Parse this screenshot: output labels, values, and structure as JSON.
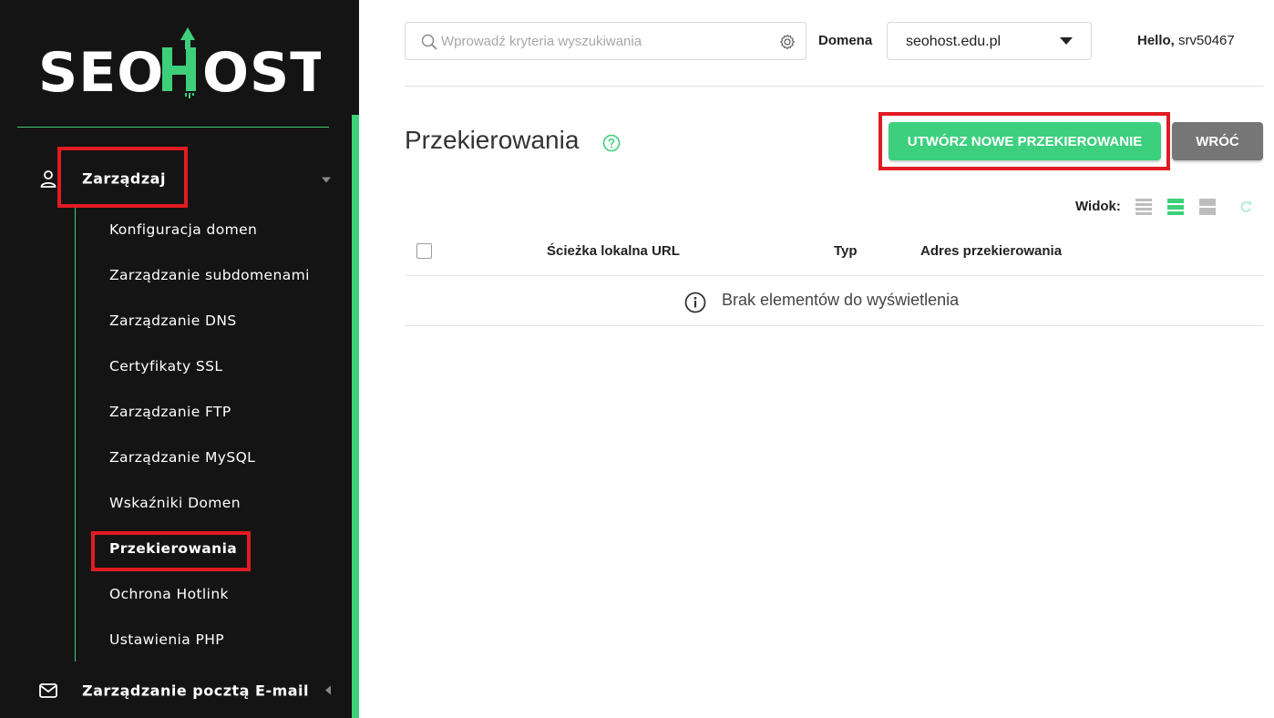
{
  "brand": {
    "name": "SEOHOST",
    "accent_color": "#3ecf7a",
    "highlight_color": "#e11b22"
  },
  "sidebar": {
    "group_manage": {
      "label": "Zarządzaj",
      "icon": "user-icon",
      "expanded": true
    },
    "items": [
      {
        "label": "Konfiguracja domen"
      },
      {
        "label": "Zarządzanie subdomenami"
      },
      {
        "label": "Zarządzanie DNS"
      },
      {
        "label": "Certyfikaty SSL"
      },
      {
        "label": "Zarządzanie FTP"
      },
      {
        "label": "Zarządzanie MySQL"
      },
      {
        "label": "Wskaźniki Domen"
      },
      {
        "label": "Przekierowania",
        "active": true
      },
      {
        "label": "Ochrona Hotlink"
      },
      {
        "label": "Ustawienia PHP"
      }
    ],
    "group_email": {
      "label": "Zarządzanie pocztą E-mail",
      "icon": "mail-icon",
      "expanded": false
    }
  },
  "topbar": {
    "search_placeholder": "Wprowadź kryteria wyszukiwania",
    "search_value": "",
    "domain_label": "Domena",
    "domain_value": "seohost.edu.pl",
    "hello_prefix": "Hello,",
    "username": "srv50467"
  },
  "page": {
    "title": "Przekierowania",
    "create_button": "UTWÓRZ NOWE PRZEKIEROWANIE",
    "back_button": "WRÓĆ",
    "view_label": "Widok:"
  },
  "table": {
    "columns": [
      "Ścieżka lokalna URL",
      "Typ",
      "Adres przekierowania"
    ],
    "rows": [],
    "empty_message": "Brak elementów do wyświetlenia"
  }
}
